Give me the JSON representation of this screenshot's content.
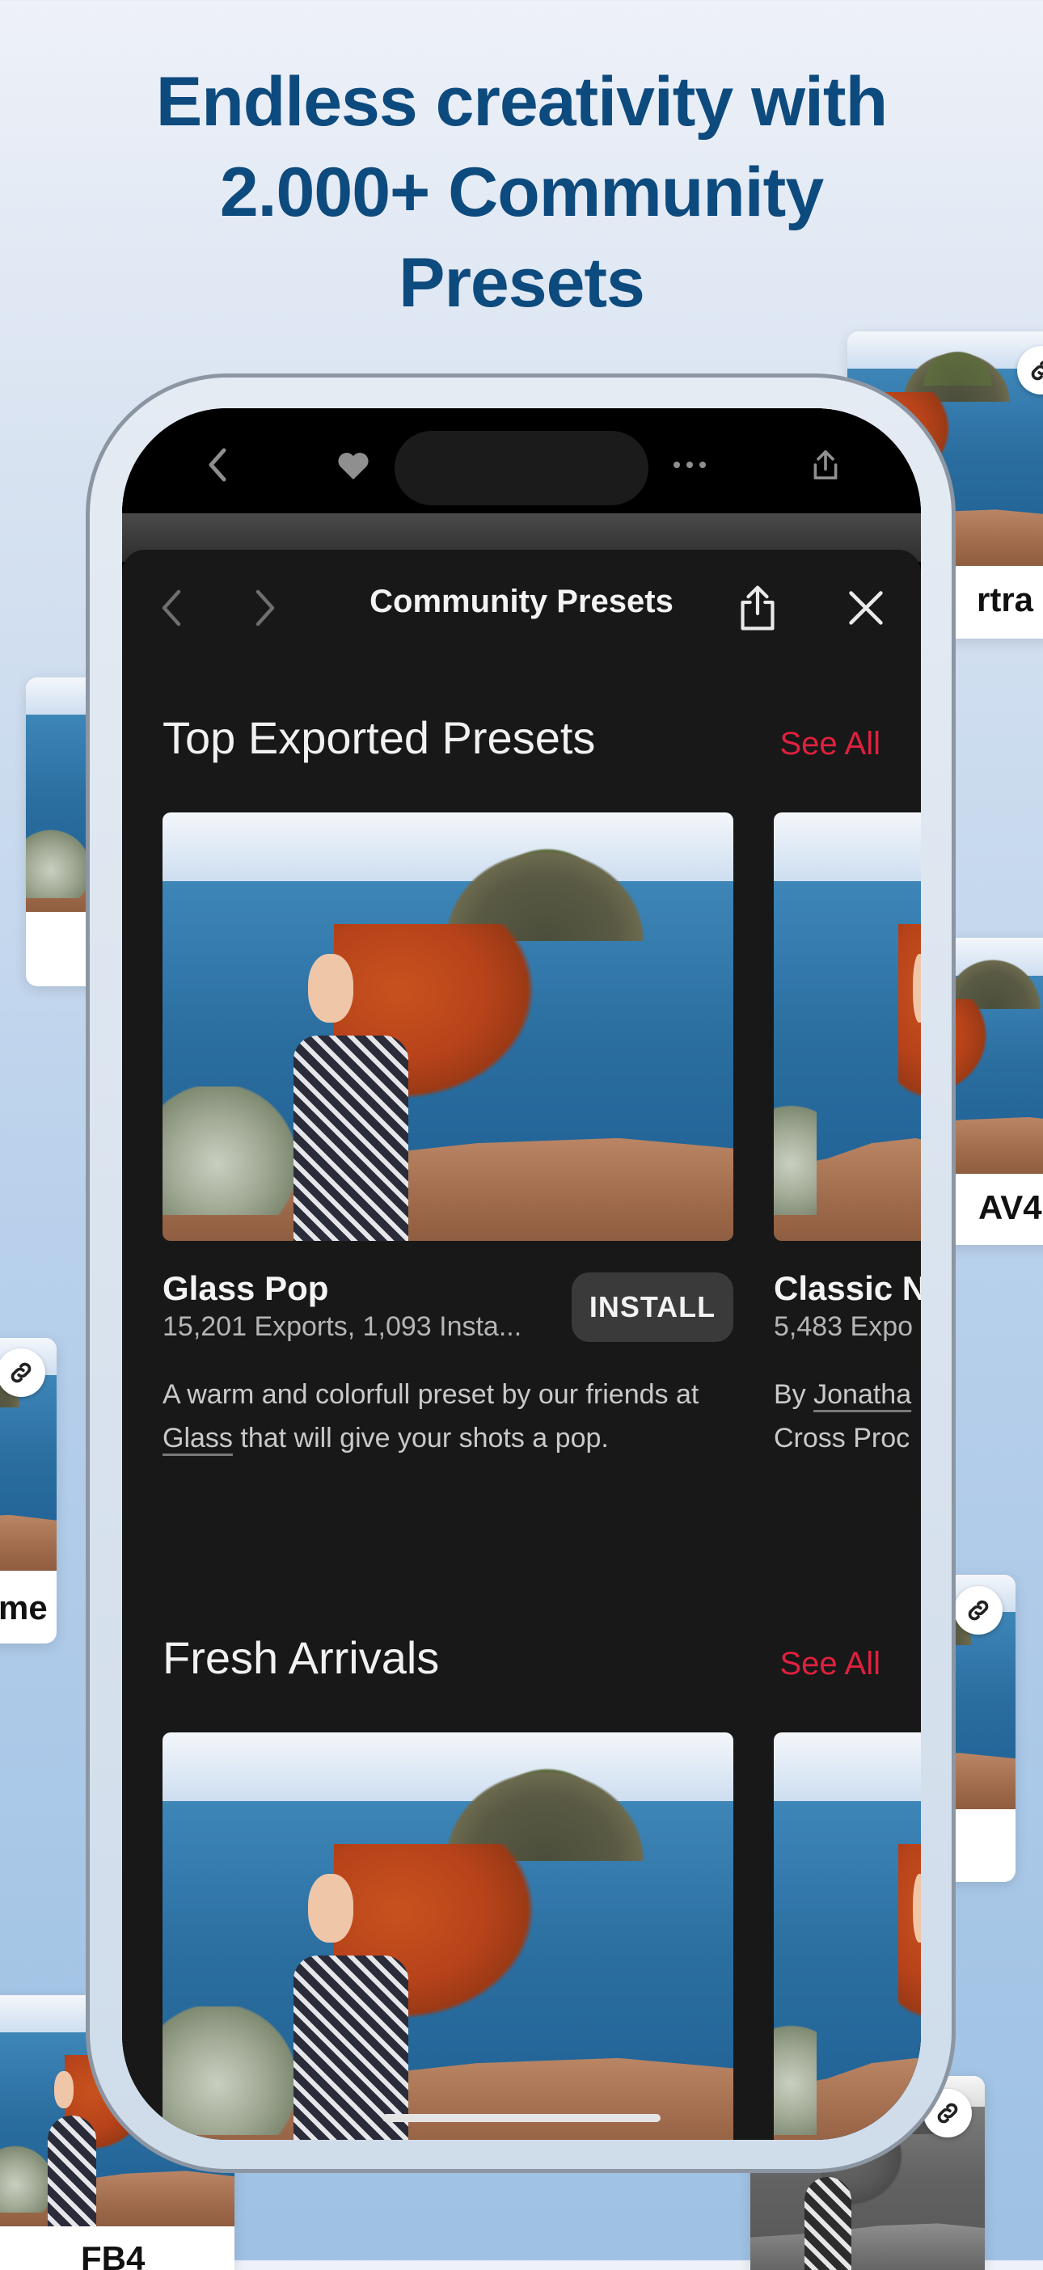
{
  "headline": {
    "line1": "Endless creativity with",
    "line2": "2.000+ Community",
    "line3": "Presets"
  },
  "floating_cards": {
    "top_right_label": "rtra",
    "mid_right_label": "AV4",
    "left_label": "me",
    "bottom_left_label": "FB4"
  },
  "status_bar": {
    "back_icon": "chevron-left-icon",
    "heart_icon": "heart-icon",
    "more_icon": "ellipsis-icon",
    "share_icon": "share-icon"
  },
  "sheet": {
    "title": "Community Presets",
    "sections": [
      {
        "title": "Top Exported Presets",
        "see_all": "See All",
        "cards": [
          {
            "name": "Glass Pop",
            "stats": "15,201 Exports, 1,093 Insta...",
            "install_label": "INSTALL",
            "desc_before": "A warm and colorfull preset by our friends at ",
            "desc_link": "Glass",
            "desc_after": " that will give your shots a pop."
          },
          {
            "name": "Classic N",
            "stats": "5,483 Expo",
            "desc_before": "By ",
            "desc_link": "Jonatha",
            "desc_line2": "Cross Proc"
          }
        ]
      },
      {
        "title": "Fresh Arrivals",
        "see_all": "See All"
      }
    ]
  },
  "colors": {
    "headline": "#0d4a7e",
    "accent": "#e0203e",
    "sheet_bg": "#181818"
  }
}
